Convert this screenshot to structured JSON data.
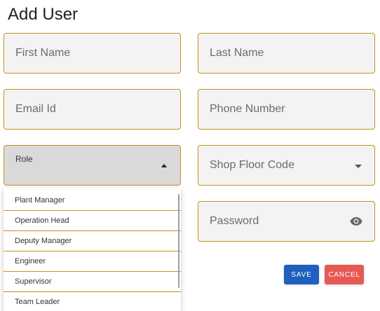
{
  "page": {
    "title": "Add User"
  },
  "form": {
    "first_name_placeholder": "First Name",
    "last_name_placeholder": "Last Name",
    "email_placeholder": "Email Id",
    "phone_placeholder": "Phone Number",
    "role_label": "Role",
    "shop_floor_placeholder": "Shop Floor Code",
    "password_placeholder": "Password"
  },
  "role_dropdown": {
    "options": [
      "Plant Manager",
      "Operation Head",
      "Deputy Manager",
      "Engineer",
      "Supervisor",
      "Team Leader"
    ]
  },
  "actions": {
    "save_label": "SAVE",
    "cancel_label": "CANCEL"
  },
  "colors": {
    "field_border": "#c8921a",
    "field_bg": "#f3f3f3",
    "save": "#1f5fbf",
    "cancel": "#e65a55"
  },
  "icons": [
    "caret-up-icon",
    "caret-down-icon",
    "eye-icon"
  ]
}
